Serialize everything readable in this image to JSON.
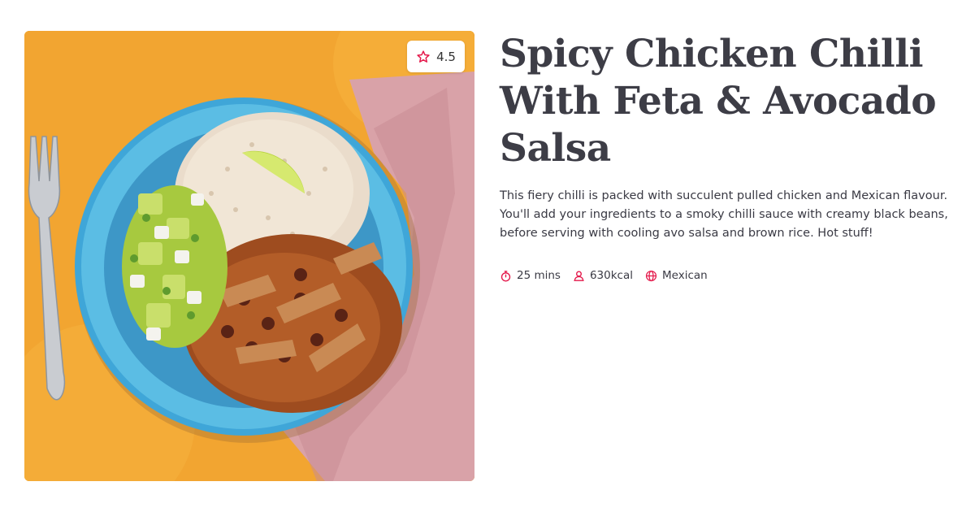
{
  "recipe": {
    "title": "Spicy Chicken Chilli With Feta & Avocado Salsa",
    "description": "This fiery chilli is packed with succulent pulled chicken and Mexican flavour. You'll add your ingredients to a smoky chilli sauce with creamy black beans, before serving with cooling avo salsa and brown rice. Hot stuff!",
    "rating": "4.5",
    "meta": {
      "time": "25 mins",
      "calories": "630kcal",
      "cuisine": "Mexican"
    }
  },
  "icons": {
    "rating": "star-icon",
    "time": "stopwatch-icon",
    "calories": "person-icon",
    "cuisine": "globe-icon"
  },
  "colors": {
    "accent": "#e4194b",
    "title": "#3d3d46",
    "background": "#ffffff"
  }
}
